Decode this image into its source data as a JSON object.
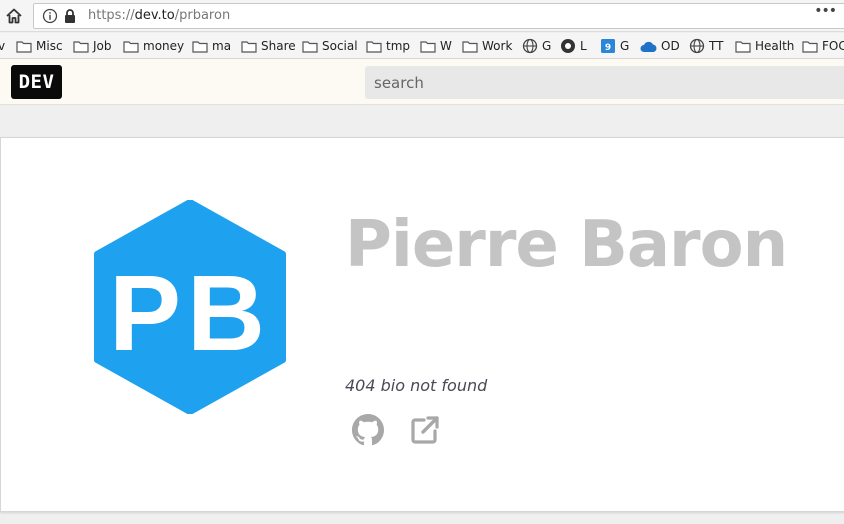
{
  "browser": {
    "url_scheme": "https://",
    "url_host": "dev.to",
    "url_path": "/prbaron",
    "more_label": "•••"
  },
  "bookmarks": [
    {
      "label": "v",
      "icon": "folder-icon"
    },
    {
      "label": "Misc",
      "icon": "folder-icon"
    },
    {
      "label": "Job",
      "icon": "folder-icon"
    },
    {
      "label": "money",
      "icon": "folder-icon"
    },
    {
      "label": "ma",
      "icon": "folder-icon"
    },
    {
      "label": "Share",
      "icon": "folder-icon"
    },
    {
      "label": "Social",
      "icon": "folder-icon"
    },
    {
      "label": "tmp",
      "icon": "folder-icon"
    },
    {
      "label": "W",
      "icon": "folder-icon"
    },
    {
      "label": "Work",
      "icon": "folder-icon"
    },
    {
      "label": "G",
      "icon": "globe-icon"
    },
    {
      "label": "L",
      "icon": "site-icon"
    },
    {
      "label": "G",
      "icon": "calendar-icon"
    },
    {
      "label": "OD",
      "icon": "cloud-icon"
    },
    {
      "label": "TT",
      "icon": "globe-icon"
    },
    {
      "label": "Health",
      "icon": "folder-icon"
    },
    {
      "label": "FOC",
      "icon": "folder-icon"
    }
  ],
  "site": {
    "logo_text": "DEV",
    "search_placeholder": "search"
  },
  "profile": {
    "name": "Pierre Baron",
    "avatar_initials": "PB",
    "bio": "404 bio not found",
    "avatar_color": "#1ea2ef",
    "name_color": "#c4c4c4"
  }
}
